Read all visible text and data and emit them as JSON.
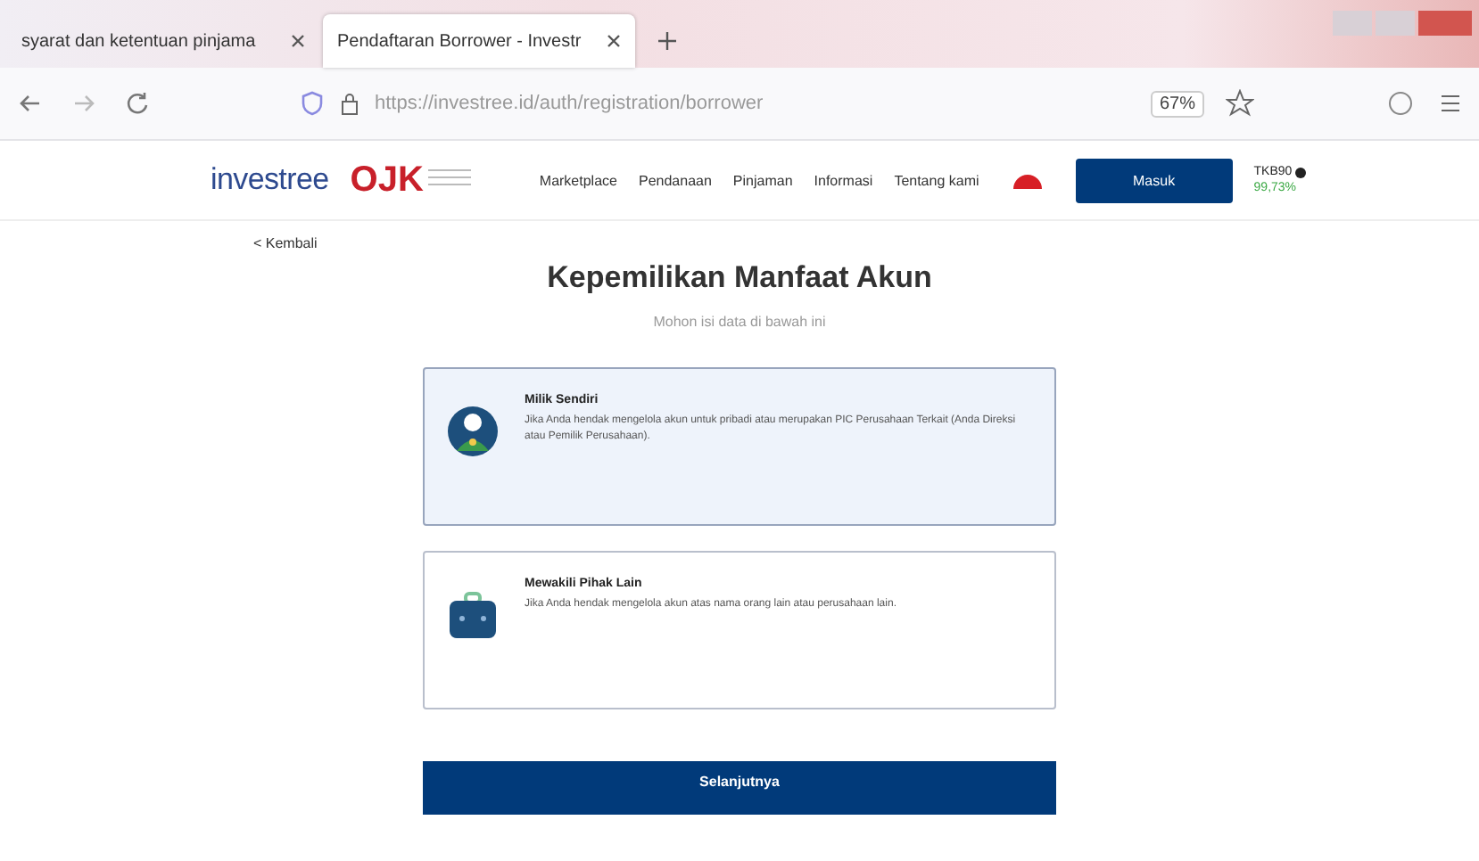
{
  "browser": {
    "tabs": [
      {
        "title": "syarat dan ketentuan pinjama",
        "selected": false
      },
      {
        "title": "Pendaftaran Borrower - Investr",
        "selected": true
      }
    ],
    "url": "https://investree.id/auth/registration/borrower",
    "zoom": "67%"
  },
  "header": {
    "logo": "investree",
    "regulator_logo": "OJK",
    "nav": [
      "Marketplace",
      "Pendanaan",
      "Pinjaman",
      "Informasi",
      "Tentang kami"
    ],
    "login_button": "Masuk",
    "tkb_label": "TKB90",
    "tkb_value": "99,73%"
  },
  "back_link": "< Kembali",
  "title": "Kepemilikan Manfaat Akun",
  "subtitle": "Mohon isi data di bawah ini",
  "options": [
    {
      "kind": "person",
      "title": "Milik Sendiri",
      "description": "Jika Anda hendak mengelola akun untuk pribadi atau merupakan PIC Perusahaan Terkait (Anda Direksi atau Pemilik Perusahaan).",
      "selected": true
    },
    {
      "kind": "briefcase",
      "title": "Mewakili Pihak Lain",
      "description": "Jika Anda hendak mengelola akun atas nama orang lain atau perusahaan lain.",
      "selected": false
    }
  ],
  "next_button": "Selanjutnya"
}
